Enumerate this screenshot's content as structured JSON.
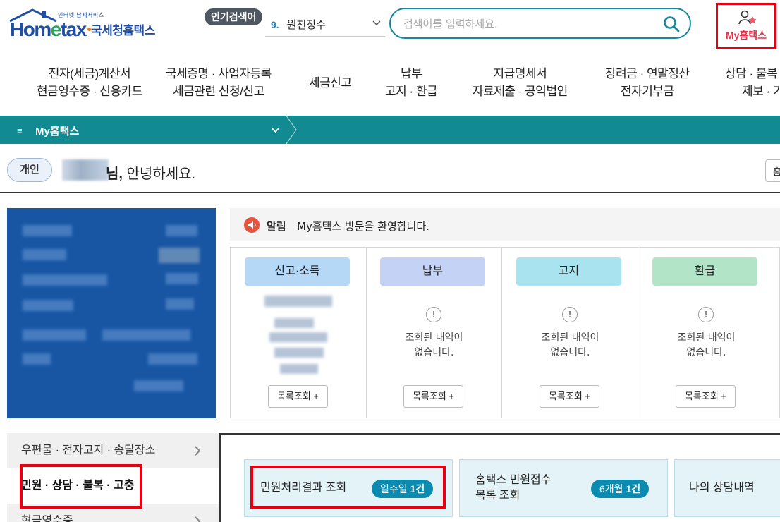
{
  "header": {
    "logo_small": "인터넷 납세서비스",
    "logo_main_a": "Hom",
    "logo_main_b": "e",
    "logo_main_c": "tax",
    "logo_korean": "국세청홈택스",
    "popular_label": "인기검색어",
    "popular_num": "9.",
    "popular_text": "원천징수",
    "search_placeholder": "검색어를 입력하세요.",
    "my_hometax": "My홈택스"
  },
  "gnb": [
    {
      "line1": "전자(세금)계산서",
      "line2": "현금영수증 · 신용카드"
    },
    {
      "line1": "국세증명 · 사업자등록",
      "line2": "세금관련 신청/신고"
    },
    {
      "line1": "세금신고",
      "line2": ""
    },
    {
      "line1": "납부",
      "line2": "고지 · 환급"
    },
    {
      "line1": "지급명세서",
      "line2": "자료제출 · 공익법인"
    },
    {
      "line1": "장려금 · 연말정산",
      "line2": "전자기부금"
    },
    {
      "line1": "상담 · 불복",
      "line2": "제보 · 기"
    }
  ],
  "nav": {
    "menu_icon": "≡",
    "title": "My홈택스"
  },
  "greeting": {
    "badge": "개인",
    "name_suffix": "님,",
    "text": " 안녕하세요.",
    "home_btn": "홈"
  },
  "notice": {
    "label": "알림",
    "message": "My홈택스 방문을 환영합니다."
  },
  "cards": [
    {
      "title": "신고·소득",
      "color": "#b5d8f7",
      "empty_line1": "",
      "empty_line2": "",
      "button": "목록조회 +"
    },
    {
      "title": "납부",
      "color": "#c4d3f5",
      "empty_line1": "조회된 내역이",
      "empty_line2": "없습니다.",
      "button": "목록조회 +"
    },
    {
      "title": "고지",
      "color": "#a9e3ef",
      "empty_line1": "조회된 내역이",
      "empty_line2": "없습니다.",
      "button": "목록조회 +"
    },
    {
      "title": "환급",
      "color": "#b2e5c8",
      "empty_line1": "조회된 내역이",
      "empty_line2": "없습니다.",
      "button": "목록조회 +"
    }
  ],
  "empty_icon": "!",
  "side_tabs": [
    {
      "label": "우편물 · 전자고지 · 송달장소"
    },
    {
      "label": "민원 · 상담 · 불복 · 고충"
    },
    {
      "label": "현금영수증"
    }
  ],
  "services": [
    {
      "title": "민원처리결과 조회",
      "badge_prefix": "일주일 ",
      "badge_count": "1건"
    },
    {
      "title_line1": "홈택스 민원접수",
      "title_line2": "목록 조회",
      "badge_prefix": "6개월 ",
      "badge_count": "1건"
    },
    {
      "title": "나의 상담내역"
    }
  ]
}
